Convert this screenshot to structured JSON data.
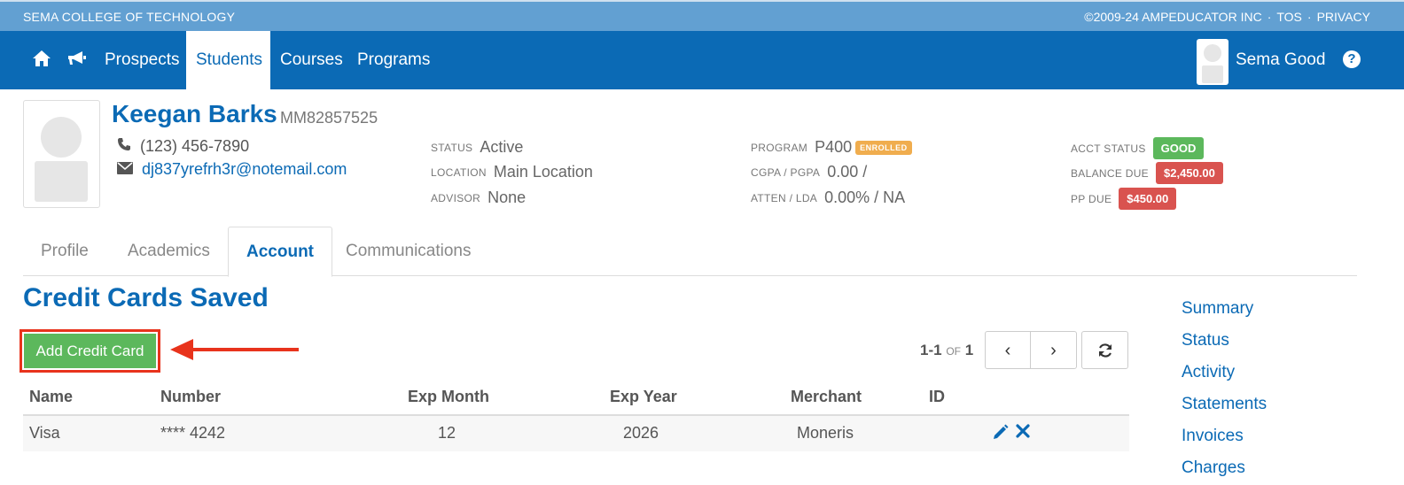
{
  "topbar": {
    "college": "SEMA COLLEGE OF TECHNOLOGY",
    "copyright": "©2009-24 AMPEDUCATOR INC",
    "sep": "·",
    "tos": "TOS",
    "privacy": "PRIVACY"
  },
  "nav": {
    "home_icon": "home-icon",
    "announce_icon": "megaphone-icon",
    "items": [
      "Prospects",
      "Students",
      "Courses",
      "Programs"
    ],
    "active": "Students",
    "user_name": "Sema Good",
    "help_glyph": "?"
  },
  "student": {
    "name": "Keegan Barks",
    "id": "MM82857525",
    "phone": "(123) 456-7890",
    "email": "dj837yrefrh3r@notemail.com"
  },
  "info": {
    "status_label": "STATUS",
    "status": "Active",
    "location_label": "LOCATION",
    "location": "Main Location",
    "advisor_label": "ADVISOR",
    "advisor": "None",
    "program_label": "PROGRAM",
    "program": "P400",
    "program_badge": "ENROLLED",
    "cgpa_label": "CGPA / PGPA",
    "cgpa": "0.00 /",
    "atten_label": "ATTEN / LDA",
    "atten": "0.00% / NA",
    "acct_label": "ACCT STATUS",
    "acct": "GOOD",
    "balance_label": "BALANCE DUE",
    "balance": "$2,450.00",
    "pp_label": "PP DUE",
    "pp": "$450.00"
  },
  "tabs": [
    "Profile",
    "Academics",
    "Account",
    "Communications"
  ],
  "active_tab": "Account",
  "section": {
    "title": "Credit Cards Saved",
    "add_button": "Add Credit Card"
  },
  "pager": {
    "range": "1-1",
    "of": "OF",
    "total": "1",
    "prev": "‹",
    "next": "›"
  },
  "table": {
    "headers": [
      "Name",
      "Number",
      "Exp Month",
      "Exp Year",
      "Merchant",
      "ID"
    ],
    "rows": [
      {
        "name": "Visa",
        "number": "**** 4242",
        "exp_month": "12",
        "exp_year": "2026",
        "merchant": "Moneris",
        "id": ""
      }
    ]
  },
  "side_links": [
    "Summary",
    "Status",
    "Activity",
    "Statements",
    "Invoices",
    "Charges"
  ],
  "colors": {
    "brand": "#0b6ab5",
    "topbar": "#62a0d2",
    "success": "#5cb85c",
    "warning": "#f0ad4e",
    "danger": "#d9534f",
    "highlight": "#e8331c"
  }
}
